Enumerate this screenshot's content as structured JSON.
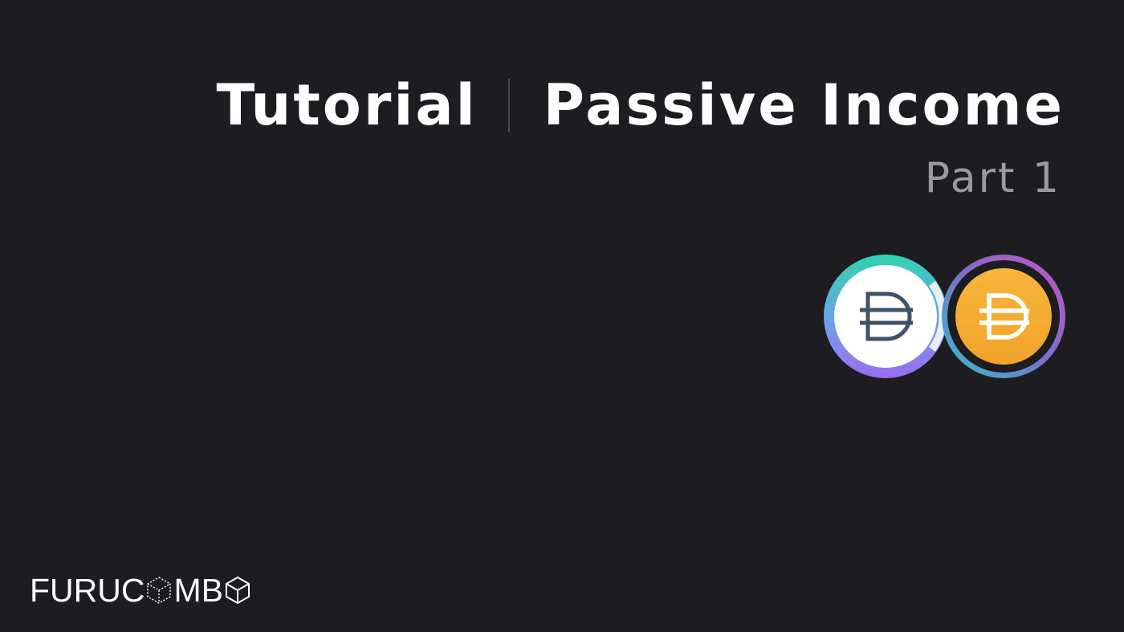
{
  "header": {
    "title_left": "Tutorial",
    "title_right": "Passive Income",
    "subtitle": "Part 1"
  },
  "tokens": [
    {
      "icon": "dai-icon",
      "ring": "teal-to-purple",
      "face_color": "#ffffff",
      "glyph_color": "#3f5266"
    },
    {
      "icon": "dai-icon",
      "ring": "purple-to-teal",
      "face_color": "#f5ac37",
      "glyph_color": "#ffffff"
    }
  ],
  "brand": {
    "text_part1": "FURUC",
    "text_part2": "MB",
    "logo_icon": "cube-icon"
  },
  "colors": {
    "background": "#1d1c21",
    "title": "#ffffff",
    "subtitle": "#9b9aa0",
    "accent_teal": "#2fd3b0",
    "accent_purple": "#9a6cf0",
    "dai_gold": "#f5ac37"
  }
}
